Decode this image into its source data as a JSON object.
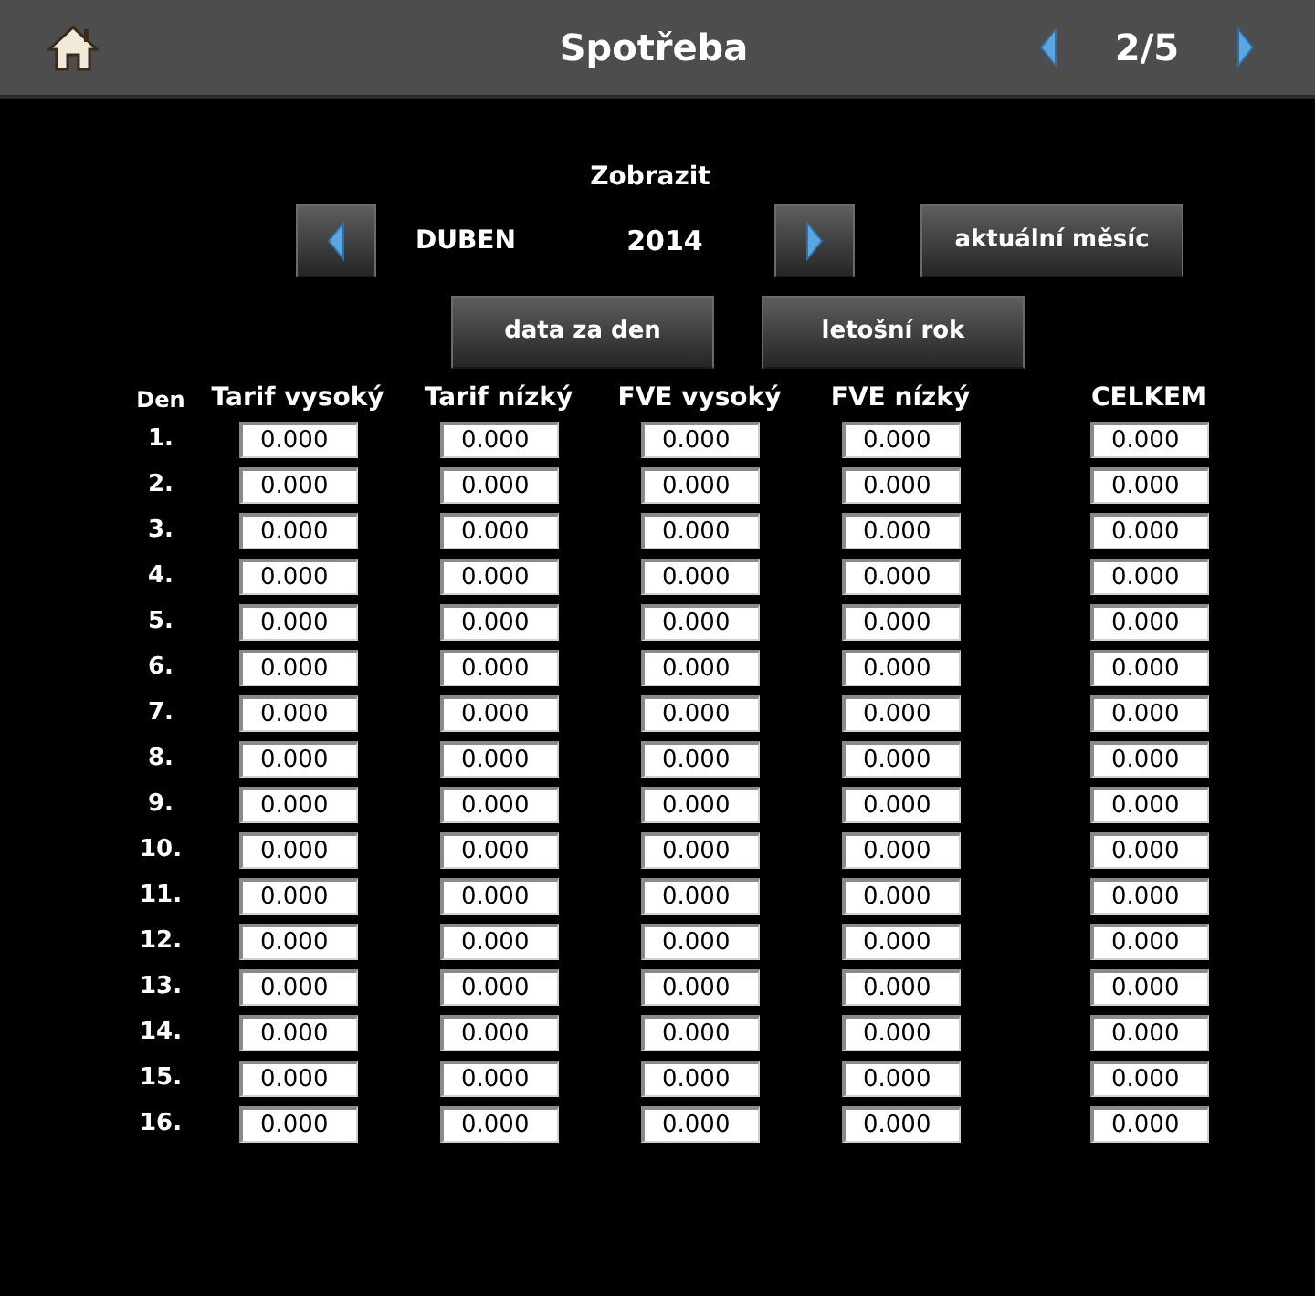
{
  "header": {
    "title": "Spotřeba",
    "page": "2/5"
  },
  "filter": {
    "label": "Zobrazit",
    "month": "DUBEN",
    "year": "2014",
    "buttons": [
      "aktuální měsíc",
      "data za den",
      "letošní rok"
    ]
  },
  "table": {
    "columns": [
      "Den",
      "Tarif vysoký",
      "Tarif nízký",
      "FVE vysoký",
      "FVE nízký",
      "CELKEM"
    ],
    "rows": [
      {
        "day": "1.",
        "values": [
          "0.000",
          "0.000",
          "0.000",
          "0.000",
          "0.000"
        ]
      },
      {
        "day": "2.",
        "values": [
          "0.000",
          "0.000",
          "0.000",
          "0.000",
          "0.000"
        ]
      },
      {
        "day": "3.",
        "values": [
          "0.000",
          "0.000",
          "0.000",
          "0.000",
          "0.000"
        ]
      },
      {
        "day": "4.",
        "values": [
          "0.000",
          "0.000",
          "0.000",
          "0.000",
          "0.000"
        ]
      },
      {
        "day": "5.",
        "values": [
          "0.000",
          "0.000",
          "0.000",
          "0.000",
          "0.000"
        ]
      },
      {
        "day": "6.",
        "values": [
          "0.000",
          "0.000",
          "0.000",
          "0.000",
          "0.000"
        ]
      },
      {
        "day": "7.",
        "values": [
          "0.000",
          "0.000",
          "0.000",
          "0.000",
          "0.000"
        ]
      },
      {
        "day": "8.",
        "values": [
          "0.000",
          "0.000",
          "0.000",
          "0.000",
          "0.000"
        ]
      },
      {
        "day": "9.",
        "values": [
          "0.000",
          "0.000",
          "0.000",
          "0.000",
          "0.000"
        ]
      },
      {
        "day": "10.",
        "values": [
          "0.000",
          "0.000",
          "0.000",
          "0.000",
          "0.000"
        ]
      },
      {
        "day": "11.",
        "values": [
          "0.000",
          "0.000",
          "0.000",
          "0.000",
          "0.000"
        ]
      },
      {
        "day": "12.",
        "values": [
          "0.000",
          "0.000",
          "0.000",
          "0.000",
          "0.000"
        ]
      },
      {
        "day": "13.",
        "values": [
          "0.000",
          "0.000",
          "0.000",
          "0.000",
          "0.000"
        ]
      },
      {
        "day": "14.",
        "values": [
          "0.000",
          "0.000",
          "0.000",
          "0.000",
          "0.000"
        ]
      },
      {
        "day": "15.",
        "values": [
          "0.000",
          "0.000",
          "0.000",
          "0.000",
          "0.000"
        ]
      },
      {
        "day": "16.",
        "values": [
          "0.000",
          "0.000",
          "0.000",
          "0.000",
          "0.000"
        ]
      }
    ]
  }
}
